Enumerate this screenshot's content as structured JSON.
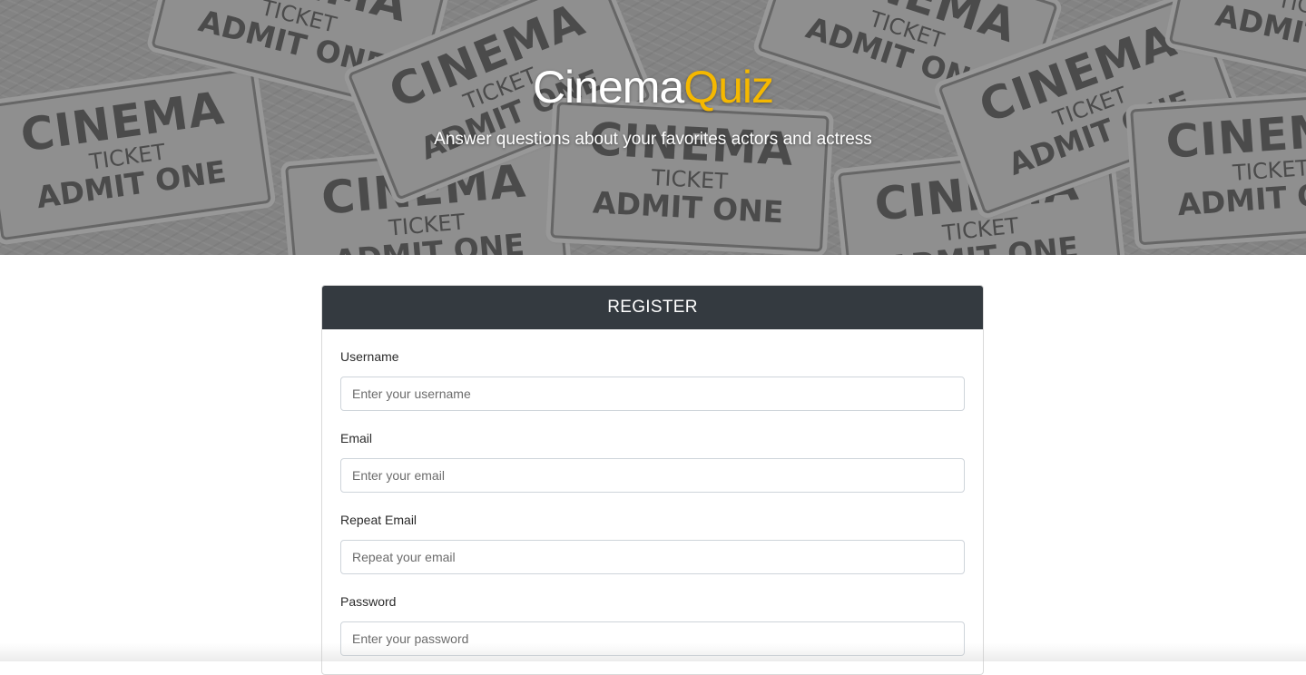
{
  "hero": {
    "brand_part1": "Cinema",
    "brand_part2": "Quiz",
    "tagline": "Answer questions about your favorites actors and actress",
    "ticket_lines": [
      "CINEMA",
      "TICKET",
      "ADMIT ONE"
    ],
    "colors": {
      "accent": "#f5b800",
      "tickets": "#9b9b9b"
    }
  },
  "register": {
    "title": "REGISTER",
    "header_color": "#343a40",
    "fields": [
      {
        "label": "Username",
        "placeholder": "Enter your username"
      },
      {
        "label": "Email",
        "placeholder": "Enter your email"
      },
      {
        "label": "Repeat Email",
        "placeholder": "Repeat your email"
      },
      {
        "label": "Password",
        "placeholder": "Enter your password"
      }
    ]
  }
}
